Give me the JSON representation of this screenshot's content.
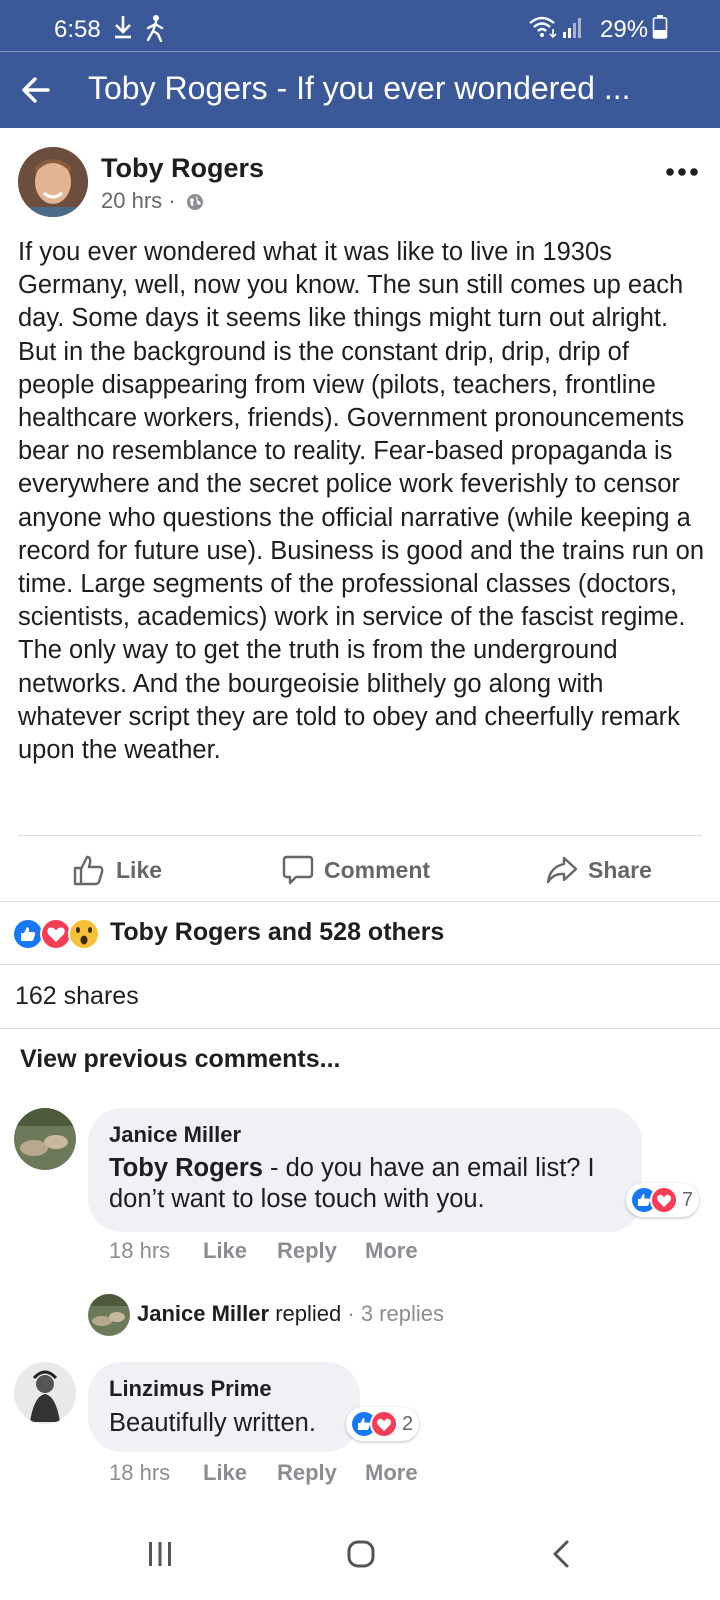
{
  "status_bar": {
    "time": "6:58",
    "battery": "29%",
    "icons": [
      "download-icon",
      "walking-icon",
      "wifi-icon",
      "signal-icon",
      "battery-icon"
    ]
  },
  "app_bar": {
    "title": "Toby Rogers - If you ever wondered ...",
    "back_icon": "back-arrow-icon"
  },
  "post": {
    "author": "Toby Rogers",
    "time": "20 hrs",
    "separator": "·",
    "privacy_icon": "globe-icon",
    "text": "If you ever wondered what it was like to live in 1930s Germany, well, now you know. The sun still comes up each day. Some days it seems like things might turn out alright. But in the background is the constant drip, drip, drip of people disappearing from view (pilots, teachers, frontline healthcare workers, friends). Government pronouncements bear no resemblance to reality. Fear-based propaganda is everywhere and the secret police work feverishly to censor anyone who questions the official narrative (while keeping a record for future use). Business is good and the trains run on time. Large segments of the professional classes (doctors, scientists, academics) work in service of the fascist regime. The only way to get the truth is from the underground networks. And the bourgeoisie blithely go along with whatever script they are told to obey and cheerfully remark upon the weather."
  },
  "actions": {
    "like": "Like",
    "comment": "Comment",
    "share": "Share"
  },
  "reactions": {
    "summary": "Toby Rogers and 528 others",
    "icons": [
      "like-reaction-icon",
      "love-reaction-icon",
      "wow-reaction-icon"
    ]
  },
  "shares": "162 shares",
  "view_previous": "View previous comments...",
  "comments": [
    {
      "name": "Janice Miller",
      "mention": "Toby Rogers",
      "text": " - do you have an email list? I don’t want to lose touch with you.",
      "time": "18 hrs",
      "like": "Like",
      "reply": "Reply",
      "more": "More",
      "reaction_count": "7"
    },
    {
      "name": "Linzimus Prime",
      "text": "Beautifully written.",
      "time": "18 hrs",
      "like": "Like",
      "reply": "Reply",
      "more": "More",
      "reaction_count": "2"
    }
  ],
  "reply_summary": {
    "name": "Janice Miller",
    "verb": "replied",
    "separator": "·",
    "count": "3 replies"
  },
  "nav": [
    "recent-apps-icon",
    "home-icon",
    "back-icon"
  ],
  "colors": {
    "brand": "#3b5998",
    "like_blue": "#1877f2",
    "love_red": "#f33e58",
    "muted": "#65676b",
    "bubble": "#eff1f4"
  }
}
